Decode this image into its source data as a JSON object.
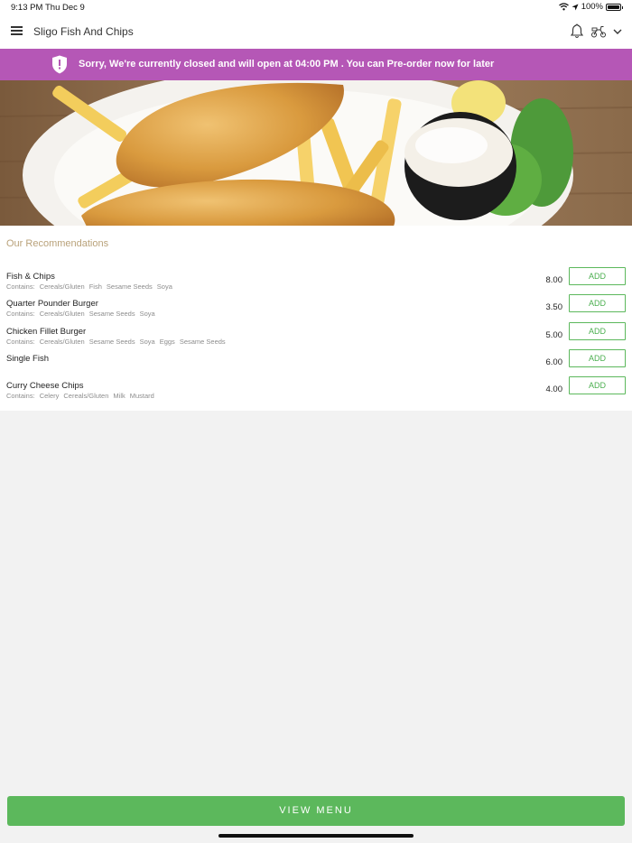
{
  "status_bar": {
    "time": "9:13 PM",
    "date": "Thu Dec 9",
    "battery": "100%"
  },
  "header": {
    "title": "Sligo Fish And Chips"
  },
  "banner": {
    "message": "Sorry, We're currently closed and will open at 04:00 PM . You can Pre-order now for later"
  },
  "recommendations": {
    "title": "Our Recommendations",
    "contains_label": "Contains:",
    "add_label": "ADD",
    "items": [
      {
        "name": "Fish & Chips",
        "price": "8.00",
        "allergens": [
          "Cereals/Gluten",
          "Fish",
          "Sesame Seeds",
          "Soya"
        ]
      },
      {
        "name": "Quarter Pounder Burger",
        "price": "3.50",
        "allergens": [
          "Cereals/Gluten",
          "Sesame Seeds",
          "Soya"
        ]
      },
      {
        "name": "Chicken Fillet Burger",
        "price": "5.00",
        "allergens": [
          "Cereals/Gluten",
          "Sesame Seeds",
          "Soya",
          "Eggs",
          "Sesame Seeds"
        ]
      },
      {
        "name": "Single Fish",
        "price": "6.00",
        "allergens": []
      },
      {
        "name": "Curry Cheese Chips",
        "price": "4.00",
        "allergens": [
          "Celery",
          "Cereals/Gluten",
          "Milk",
          "Mustard"
        ]
      }
    ]
  },
  "footer": {
    "view_menu_label": "VIEW MENU"
  },
  "colors": {
    "banner": "#b557b6",
    "accent_green": "#5cb85c",
    "section_title": "#b9a27a"
  },
  "icons": [
    "menu-icon",
    "bell-icon",
    "scooter-icon",
    "chevron-down-icon",
    "shield-alert-icon",
    "wifi-icon",
    "location-icon",
    "battery-icon"
  ]
}
